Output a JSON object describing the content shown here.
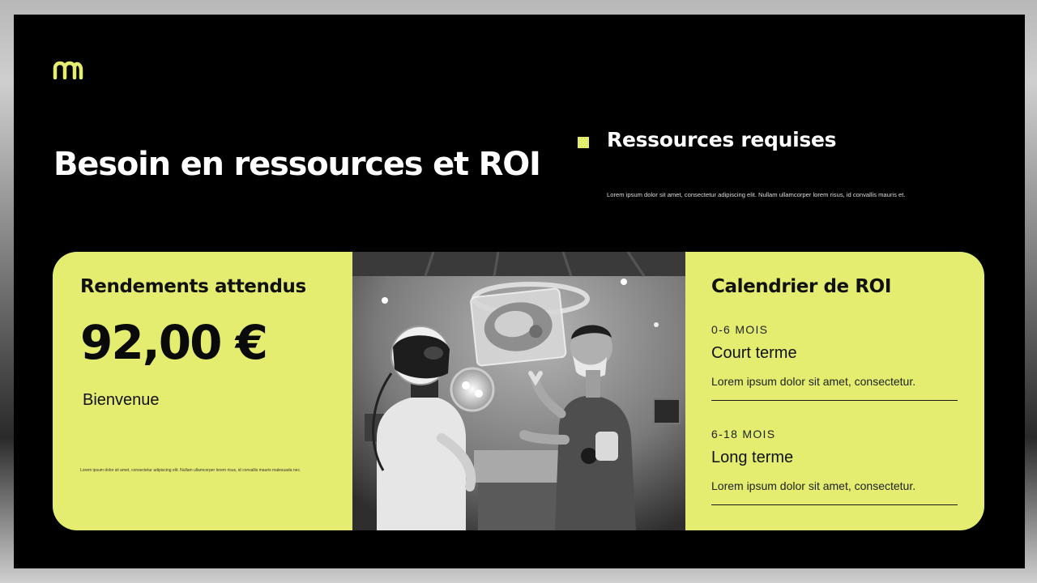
{
  "colors": {
    "accent": "#e4ed6f",
    "background": "#000000",
    "text_light": "#ffffff",
    "text_dark": "#111111"
  },
  "logo": {
    "icon": "m-monogram-icon"
  },
  "title": "Besoin en ressources et ROI",
  "resources": {
    "bullet_icon": "square-bullet-icon",
    "heading": "Ressources requises",
    "text": "Lorem ipsum dolor sit amet, consectetur adipiscing elit. Nullam ullamcorper lorem risus, id convallis mauris et."
  },
  "returns": {
    "heading": "Rendements attendus",
    "amount": "92,00 €",
    "subtitle": "Bienvenue",
    "fine_print": "Lorem ipsum dolor sit amet, consectetur adipiscing elit. Nullam ullamcorper lorem risus, id convallis mauris malesuada nec."
  },
  "photo": {
    "subject": "humanoid-robot-and-surgeon-in-operating-room"
  },
  "roi": {
    "heading": "Calendrier de ROI",
    "terms": [
      {
        "range": "0-6 MOIS",
        "name": "Court terme",
        "description": "Lorem ipsum dolor sit amet, consectetur."
      },
      {
        "range": "6-18 MOIS",
        "name": "Long terme",
        "description": "Lorem ipsum dolor sit amet, consectetur."
      }
    ]
  }
}
